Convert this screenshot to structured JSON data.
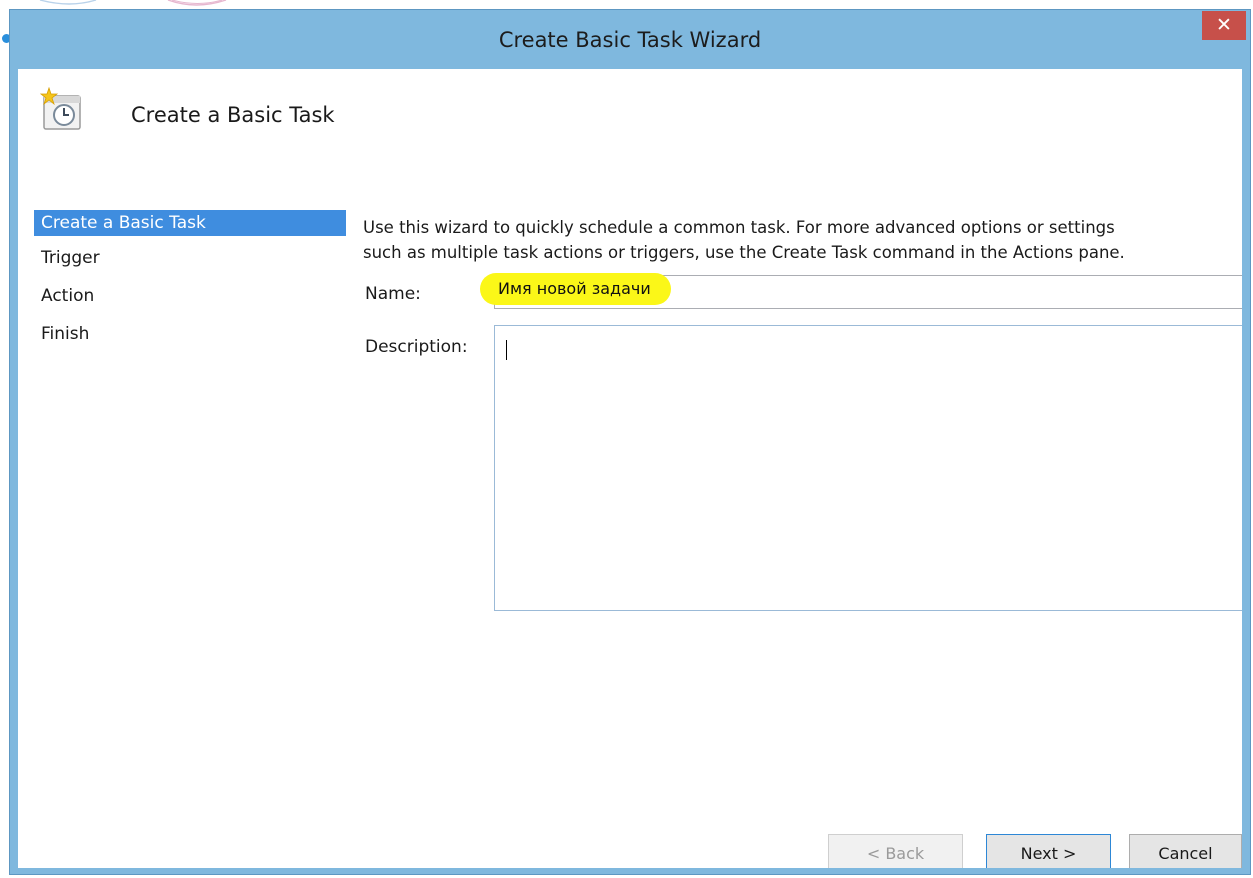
{
  "window": {
    "title": "Create Basic Task Wizard",
    "close_label": "✕"
  },
  "header": {
    "title": "Create a Basic Task",
    "icon": "scheduled-task-clock-icon"
  },
  "nav": {
    "items": [
      {
        "label": "Create a Basic Task",
        "active": true
      },
      {
        "label": "Trigger",
        "active": false
      },
      {
        "label": "Action",
        "active": false
      },
      {
        "label": "Finish",
        "active": false
      }
    ]
  },
  "main": {
    "intro_lines": [
      "Use this wizard to quickly schedule a common task.  For more advanced options or settings",
      "such as multiple task actions or triggers, use the Create Task command in the Actions pane."
    ],
    "name_label": "Name:",
    "name_value": "Имя новой задачи",
    "description_label": "Description:",
    "description_value": ""
  },
  "buttons": {
    "back": "< Back",
    "next": "Next >",
    "cancel": "Cancel"
  },
  "colors": {
    "frame": "#7fb8de",
    "active_nav": "#3f8ddf",
    "close_button": "#c7504a",
    "highlight": "#fbf718"
  }
}
